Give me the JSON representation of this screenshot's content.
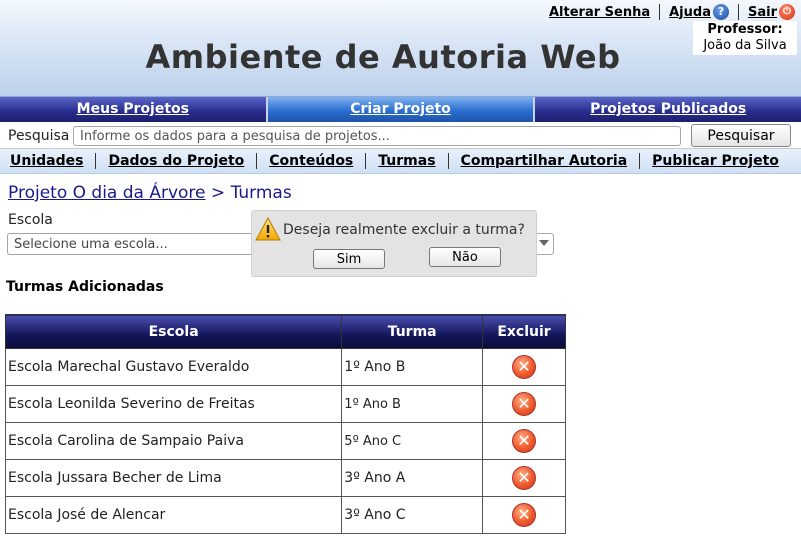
{
  "header": {
    "title": "Ambiente de Autoria Web",
    "links": {
      "change_password": "Alterar Senha",
      "help": "Ajuda",
      "logout": "Sair"
    },
    "professor_label": "Professor:",
    "professor_name": "João da Silva"
  },
  "main_nav": {
    "tabs": [
      {
        "label": "Meus Projetos"
      },
      {
        "label": "Criar Projeto",
        "active": true
      },
      {
        "label": "Projetos Publicados"
      }
    ]
  },
  "search": {
    "label": "Pesquisa",
    "placeholder": "Informe os dados para a pesquisa de projetos...",
    "button": "Pesquisar"
  },
  "sub_nav": {
    "items": [
      "Unidades",
      "Dados do Projeto",
      "Conteúdos",
      "Turmas",
      "Compartilhar Autoria",
      "Publicar Projeto"
    ]
  },
  "breadcrumb": {
    "project_link": "Projeto O dia da Árvore",
    "current": " > Turmas"
  },
  "school_select": {
    "label": "Escola",
    "placeholder": "Selecione uma escola..."
  },
  "classes": {
    "title": "Turmas Adicionadas",
    "columns": [
      "Escola",
      "Turma",
      "Excluir"
    ],
    "rows": [
      {
        "escola": "Escola Marechal Gustavo Everaldo",
        "turma": "1º Ano B"
      },
      {
        "escola": "Escola Leonilda Severino de Freitas",
        "turma": "1º Ano B"
      },
      {
        "escola": "Escola Carolina de Sampaio Paiva",
        "turma": "5º Ano C"
      },
      {
        "escola": "Escola Jussara Becher de Lima",
        "turma": "3º Ano A"
      },
      {
        "escola": "Escola José de Alencar",
        "turma": "3º Ano C"
      }
    ]
  },
  "dialog": {
    "message": "Deseja realmente excluir a turma?",
    "yes": "Sim",
    "no": "Não"
  },
  "colors": {
    "nav_dark": "#1c1f6e",
    "nav_active": "#2b6fd0",
    "link_blue": "#1a1a8c",
    "delete_red": "#ef5a2b"
  }
}
